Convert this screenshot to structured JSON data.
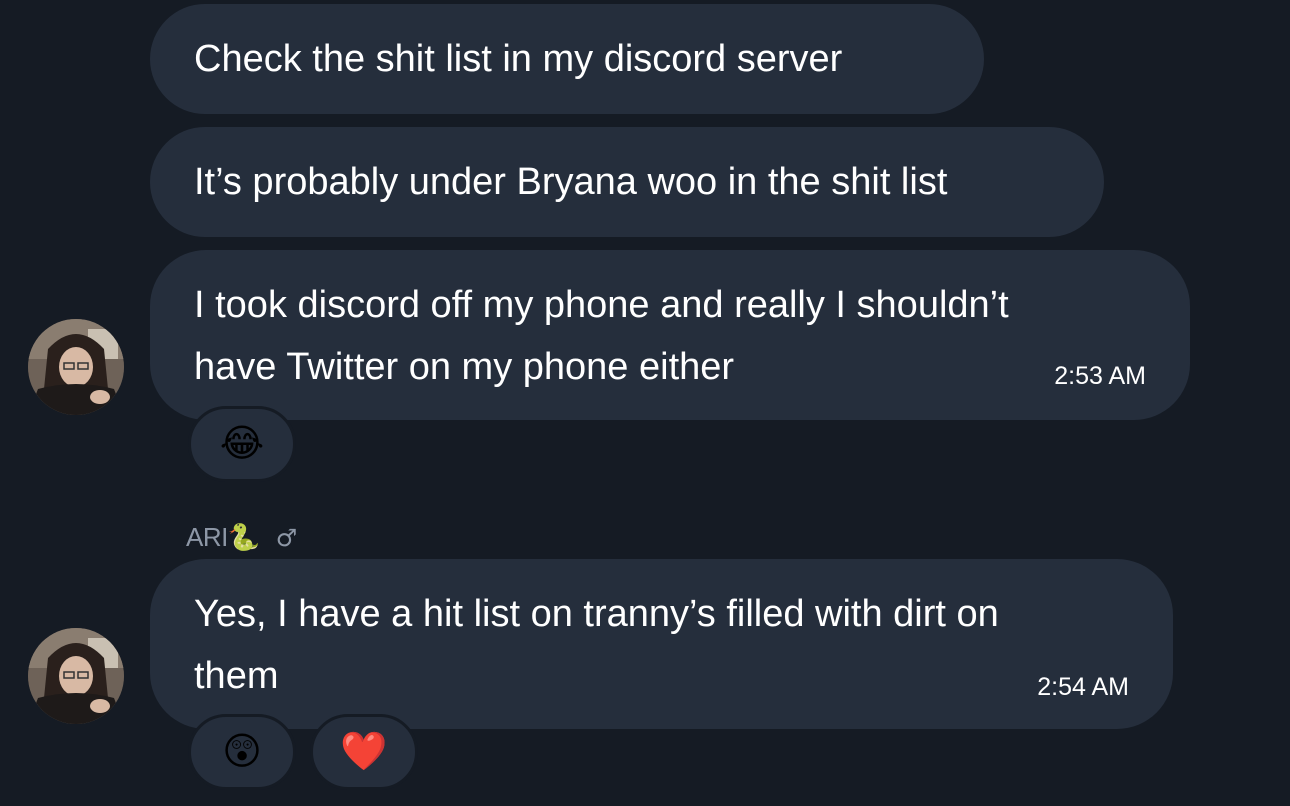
{
  "messages": [
    {
      "text": "Check the shit list in my discord server"
    },
    {
      "text": "It’s probably under Bryana woo in the shit list"
    },
    {
      "line1": "I took discord off my phone and really I shouldn’t",
      "line2": "have Twitter on my phone either",
      "time": "2:53 AM",
      "reactions": [
        {
          "emoji": "😂",
          "name": "face-with-tears-of-joy"
        }
      ]
    },
    {
      "line1": "Yes, I have a hit list on tranny’s filled with dirt on",
      "line2": "them",
      "time": "2:54 AM",
      "reactions": [
        {
          "emoji": "😲",
          "name": "astonished-face"
        },
        {
          "emoji": "❤️",
          "name": "red-heart"
        }
      ]
    }
  ],
  "sender": {
    "name": "ARI",
    "emoji": "🐍",
    "gender_symbol": "♂"
  },
  "colors": {
    "background": "#151b24",
    "bubble": "#252e3c",
    "text": "#ffffff",
    "sender_name": "#8d97a6"
  }
}
